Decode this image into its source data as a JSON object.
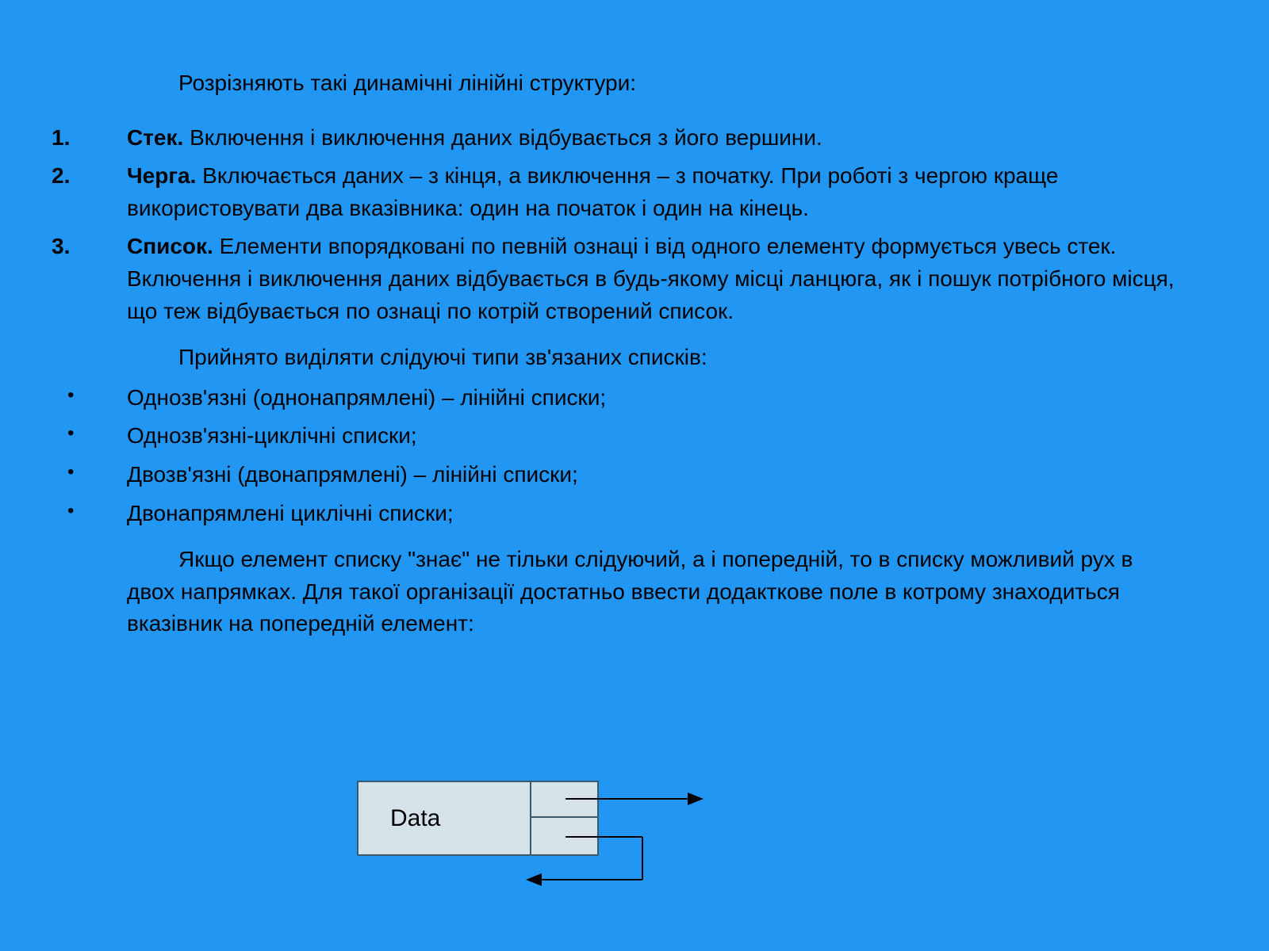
{
  "intro": "Розрізняють такі динамічні лінійні структури:",
  "items": [
    {
      "num": "1.",
      "title": "Стек.",
      "text": " Включення і виключення даних відбувається з його вершини."
    },
    {
      "num": "2.",
      "title": "Черга.",
      "text": " Включається даних – з кінця, а виключення – з початку. При роботі з чергою краще використовувати два вказівника: один на початок і один на кінець."
    },
    {
      "num": "3.",
      "title": "Список.",
      "text": " Елементи впорядковані по певній ознаці і від одного елементу формується увесь стек. Включення і виключення даних відбувається в будь-якому місці ланцюга, як і пошук потрібного місця, що теж відбувається по  ознаці по котрій створений список."
    }
  ],
  "sub_intro": "Прийнято виділяти слідуючі типи зв'язаних списків:",
  "bullets": [
    "Однозв'язні (однонапрямлені) – лінійні списки;",
    "Однозв'язні-циклічні списки;",
    "Двозв'язні (двонапрямлені) – лінійні списки;",
    "Двонапрямлені циклічні списки;"
  ],
  "paragraph": "Якщо елемент списку \"знає\" не тільки слідуючий, а і попередній, то в списку можливий рух в двох напрямках. Для такої організації достатньо ввести додакткове поле в котрому знаходиться вказівник на попередній елемент:",
  "diagram": {
    "label": "Data"
  }
}
